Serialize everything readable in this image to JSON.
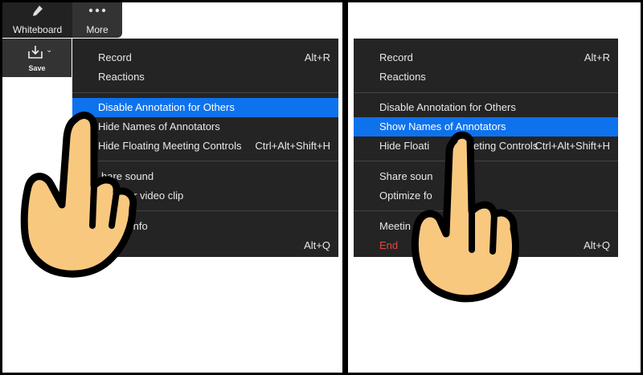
{
  "toolbar": {
    "whiteboard_label": "Whiteboard",
    "more_label": "More",
    "save_label": "Save",
    "icons": [
      "pencil-icon",
      "more-dots-icon",
      "save-download-icon",
      "chevron-down-icon"
    ]
  },
  "menu_left": {
    "record": {
      "label": "Record",
      "shortcut": "Alt+R"
    },
    "reactions": {
      "label": "Reactions"
    },
    "disable_annotation": {
      "label": "Disable Annotation for Others"
    },
    "hide_names": {
      "label": "Hide Names of Annotators"
    },
    "hide_floating": {
      "label": "Hide Floating Meeting Controls",
      "shortcut": "Ctrl+Alt+Shift+H"
    },
    "share_sound": {
      "label": "hare sound"
    },
    "optimize": {
      "label": "ize for video clip"
    },
    "meeting_info": {
      "label": "ng Info"
    },
    "end": {
      "shortcut": "Alt+Q"
    }
  },
  "menu_right": {
    "record": {
      "label": "Record",
      "shortcut": "Alt+R"
    },
    "reactions": {
      "label": "Reactions"
    },
    "disable_annotation": {
      "label": "Disable Annotation for Others"
    },
    "show_names": {
      "label": "Show Names of Annotators"
    },
    "hide_floating": {
      "label": "Hide Floati",
      "label_end": "eting Controls",
      "shortcut": "Ctrl+Alt+Shift+H"
    },
    "share_sound": {
      "label": "Share soun"
    },
    "optimize": {
      "label": "Optimize fo"
    },
    "meeting_info": {
      "label": "Meetin"
    },
    "end": {
      "label": "End",
      "shortcut": "Alt+Q"
    }
  },
  "colors": {
    "highlight": "#0e72ed",
    "menu_bg": "#242424",
    "end_text": "#e8463c",
    "hand_fill": "#f8c87f"
  }
}
